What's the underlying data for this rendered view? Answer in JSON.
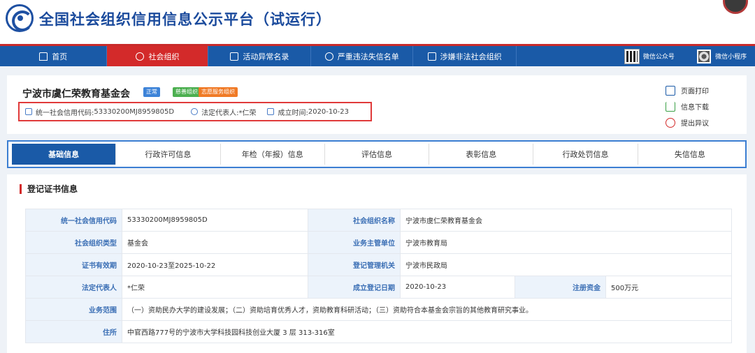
{
  "header": {
    "title": "全国社会组织信用信息公示平台（试运行）"
  },
  "nav": {
    "items": [
      {
        "label": "首页",
        "icon": "home-icon",
        "active": false
      },
      {
        "label": "社会组织",
        "icon": "org-icon",
        "active": true
      },
      {
        "label": "活动异常名录",
        "icon": "list-icon",
        "active": false
      },
      {
        "label": "严重违法失信名单",
        "icon": "shield-icon",
        "active": false
      },
      {
        "label": "涉嫌非法社会组织",
        "icon": "alert-icon",
        "active": false
      }
    ],
    "wechat_official": "微信公众号",
    "wechat_mini": "微信小程序"
  },
  "org": {
    "name": "宁波市虞仁荣教育基金会",
    "badges": [
      "正常",
      "慈善组织",
      "志愿服务组织"
    ],
    "credit_code_label": "统一社会信用代码: ",
    "credit_code": "53330200MJ8959805D",
    "legal_rep_label": "法定代表人: ",
    "legal_rep": "*仁荣",
    "founded_label": "成立时间: ",
    "founded": "2020-10-23"
  },
  "actions": {
    "print": "页面打印",
    "download": "信息下载",
    "objection": "提出异议"
  },
  "tabs": [
    "基础信息",
    "行政许可信息",
    "年检（年报）信息",
    "评估信息",
    "表彰信息",
    "行政处罚信息",
    "失信信息"
  ],
  "section": {
    "title": "登记证书信息"
  },
  "table": {
    "credit_code_label": "统一社会信用代码",
    "credit_code": "53330200MJ8959805D",
    "org_name_label": "社会组织名称",
    "org_name": "宁波市虞仁荣教育基金会",
    "type_label": "社会组织类型",
    "type": "基金会",
    "supervisor_label": "业务主管单位",
    "supervisor": "宁波市教育局",
    "validity_label": "证书有效期",
    "validity": "2020-10-23至2025-10-22",
    "registry_label": "登记管理机关",
    "registry": "宁波市民政局",
    "legal_rep_label": "法定代表人",
    "legal_rep": "*仁荣",
    "reg_date_label": "成立登记日期",
    "reg_date": "2020-10-23",
    "capital_label": "注册资金",
    "capital": "500万元",
    "scope_label": "业务范围",
    "scope": "（一）资助民办大学的建设发展；（二）资助培育优秀人才，资助教育科研活动；（三）资助符合本基金会宗旨的其他教育研究事业。",
    "address_label": "住所",
    "address": "中官西路777号的宁波市大学科技园科技创业大厦 3 层 313-316室"
  },
  "colors": {
    "primary": "#1a5aa7",
    "accent_red": "#d32a2a",
    "label_bg": "#ecf3fb"
  }
}
